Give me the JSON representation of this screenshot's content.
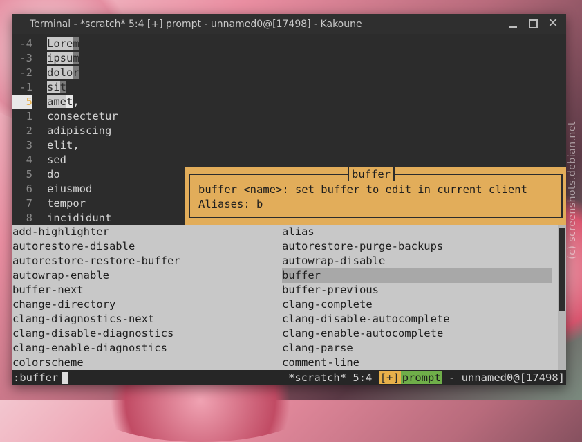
{
  "window": {
    "title": "Terminal - *scratch* 5:4 [+] prompt - unnamed0@[17498] - Kakoune"
  },
  "editor": {
    "lines": [
      {
        "num": "-4",
        "parts": [
          {
            "t": "Lore",
            "c": "sel"
          },
          {
            "t": "m",
            "c": "sel2"
          }
        ]
      },
      {
        "num": "-3",
        "parts": [
          {
            "t": "ipsu",
            "c": "sel"
          },
          {
            "t": "m",
            "c": "sel2"
          }
        ]
      },
      {
        "num": "-2",
        "parts": [
          {
            "t": "dolo",
            "c": "sel"
          },
          {
            "t": "r",
            "c": "sel2"
          }
        ]
      },
      {
        "num": "-1",
        "parts": [
          {
            "t": "si",
            "c": "sel"
          },
          {
            "t": "t",
            "c": "sel2"
          }
        ]
      },
      {
        "num": "5",
        "current": true,
        "parts": [
          {
            "t": "ame",
            "c": "sel"
          },
          {
            "t": "t",
            "c": "cur"
          },
          {
            "t": ",",
            "c": ""
          }
        ]
      },
      {
        "num": "1",
        "parts": [
          {
            "t": "consectetur",
            "c": ""
          }
        ]
      },
      {
        "num": "2",
        "parts": [
          {
            "t": "adipiscing",
            "c": ""
          }
        ]
      },
      {
        "num": "3",
        "parts": [
          {
            "t": "elit,",
            "c": ""
          }
        ]
      },
      {
        "num": "4",
        "parts": [
          {
            "t": "sed",
            "c": ""
          }
        ]
      },
      {
        "num": "5",
        "parts": [
          {
            "t": "do",
            "c": ""
          }
        ]
      },
      {
        "num": "6",
        "parts": [
          {
            "t": "eiusmod",
            "c": ""
          }
        ]
      },
      {
        "num": "7",
        "parts": [
          {
            "t": "tempor",
            "c": ""
          }
        ]
      },
      {
        "num": "8",
        "parts": [
          {
            "t": "incididunt",
            "c": ""
          }
        ]
      }
    ]
  },
  "info_box": {
    "title": "buffer",
    "lines": [
      "buffer <name>: set buffer to edit in current client",
      "Aliases: b"
    ]
  },
  "completion": {
    "left": [
      "add-highlighter",
      "autorestore-disable",
      "autorestore-restore-buffer",
      "autowrap-enable",
      "buffer-next",
      "change-directory",
      "clang-diagnostics-next",
      "clang-disable-diagnostics",
      "clang-enable-diagnostics",
      "colorscheme"
    ],
    "right": [
      "alias",
      "autorestore-purge-backups",
      "autowrap-disable",
      "buffer",
      "buffer-previous",
      "clang-complete",
      "clang-disable-autocomplete",
      "clang-enable-autocomplete",
      "clang-parse",
      "comment-line"
    ],
    "selected": "buffer"
  },
  "status": {
    "prompt": ":buffer",
    "buffer": "*scratch* 5:4 ",
    "modified": "[+]",
    "mode": "prompt",
    "client": " - unnamed0@[17498]"
  },
  "watermark": "(c) screenshots.debian.net",
  "colors": {
    "accent": "#e2ad5a",
    "mode_green": "#6fae49",
    "menu_bg": "#c8c8c8",
    "terminal_bg": "#2c2c2c"
  }
}
